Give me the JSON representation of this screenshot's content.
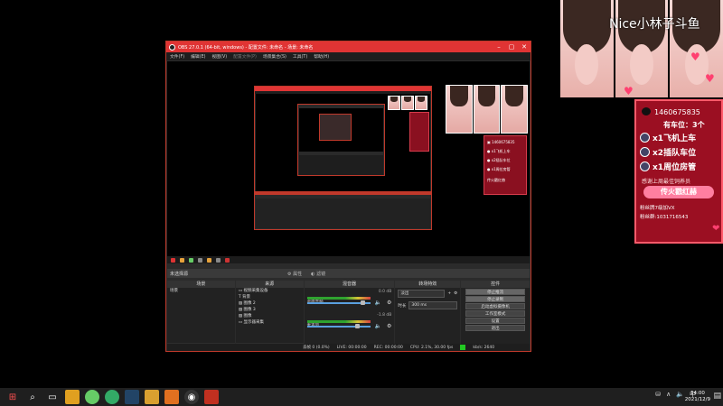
{
  "obs": {
    "title": "OBS 27.0.1 (64-bit, windows) - 配置文件: 未命名 - 场景: 未命名",
    "menu": [
      "文件(F)",
      "编辑(E)",
      "视图(V)",
      "配置文件(P)",
      "场景集合(S)",
      "工具(T)",
      "帮助(H)"
    ],
    "dock_header": {
      "no_source": "未选择源",
      "properties": "属性",
      "filters": "滤镜"
    },
    "scenes": {
      "title": "场景",
      "items": [
        "场景"
      ]
    },
    "sources": {
      "title": "来源",
      "items": [
        "视频采集设备",
        "背景",
        "图像 2",
        "图像 3",
        "图像",
        "显示器采集"
      ]
    },
    "mixer": {
      "title": "混音器",
      "channels": [
        {
          "name": "桌面音频",
          "db": "0.0 dB"
        },
        {
          "name": "麦克风",
          "db": "-1.8 dB"
        }
      ]
    },
    "transitions": {
      "title": "转场特效",
      "type": "淡出",
      "duration_label": "时长",
      "duration": "300 ms"
    },
    "controls": {
      "title": "控件",
      "buttons": [
        "停止推流",
        "停止录制",
        "启动虚拟摄像机",
        "工作室模式",
        "设置",
        "退出"
      ]
    },
    "status": {
      "dropped": "丢帧 0 (0.0%)",
      "live": "LIVE: 00:00:00",
      "rec": "REC: 00:00:00",
      "cpu": "CPU: 2.1%, 30.00 fps",
      "kbs": "kb/s: 2640"
    }
  },
  "overlay": {
    "brand": "Nice小林子斗鱼",
    "qq": "1460675835",
    "seats": "有车位：3个",
    "lines": [
      "x1飞机上车",
      "x2插队车位",
      "x1周位房管"
    ],
    "thanks": "感谢上周最佳饲养员",
    "banner": "传火戳红赫",
    "fans1": "粉丝牌7级加VX",
    "fans2": "粉丝群:1031716543"
  },
  "taskbar": {
    "time": "14:00",
    "date": "2021/12/9",
    "lang": "中"
  }
}
